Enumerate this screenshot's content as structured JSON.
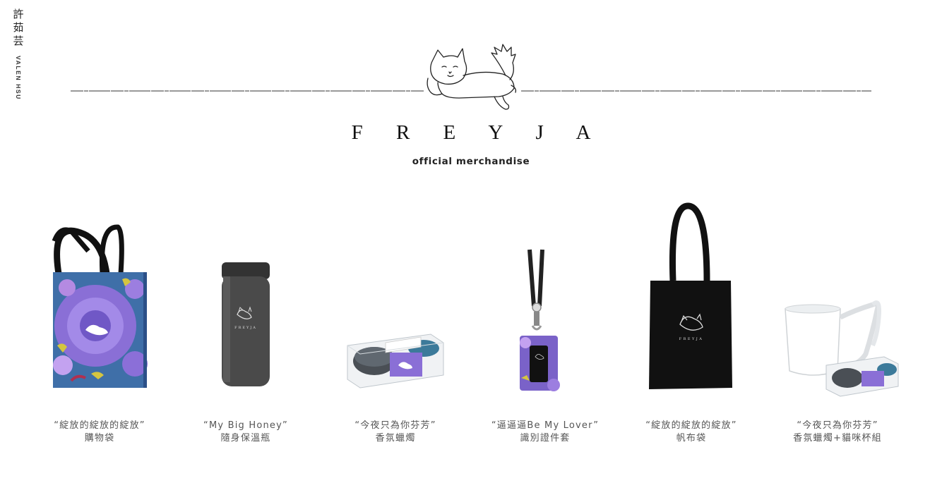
{
  "artist": {
    "name_cn": "許茹芸",
    "name_en": "VALEN HSU"
  },
  "brand": {
    "title": "F R E Y J A",
    "subtitle": "official merchandise",
    "logo_icon": "lying-cat-icon"
  },
  "products": [
    {
      "name": "“綻放的綻放的綻放”",
      "type": "購物袋",
      "icon": "floral-shopping-bag"
    },
    {
      "name": "“My Big Honey”",
      "type": "隨身保溫瓶",
      "icon": "tumbler"
    },
    {
      "name": "“今夜只為你芬芳”",
      "type": "香氛蠟燭",
      "icon": "candle-box"
    },
    {
      "name": "“逼逼逼Be My Lover”",
      "type": "識別證件套",
      "icon": "lanyard-card-holder"
    },
    {
      "name": "“綻放的綻放的綻放”",
      "type": "帆布袋",
      "icon": "black-tote-bag"
    },
    {
      "name": "“今夜只為你芬芳”",
      "type": "香氛蠟燭+貓咪杯組",
      "icon": "cat-mug-candle-set"
    }
  ],
  "colors": {
    "accent_purple": "#8a6fd6",
    "dark_navy": "#1d2a4e",
    "black": "#111111"
  }
}
